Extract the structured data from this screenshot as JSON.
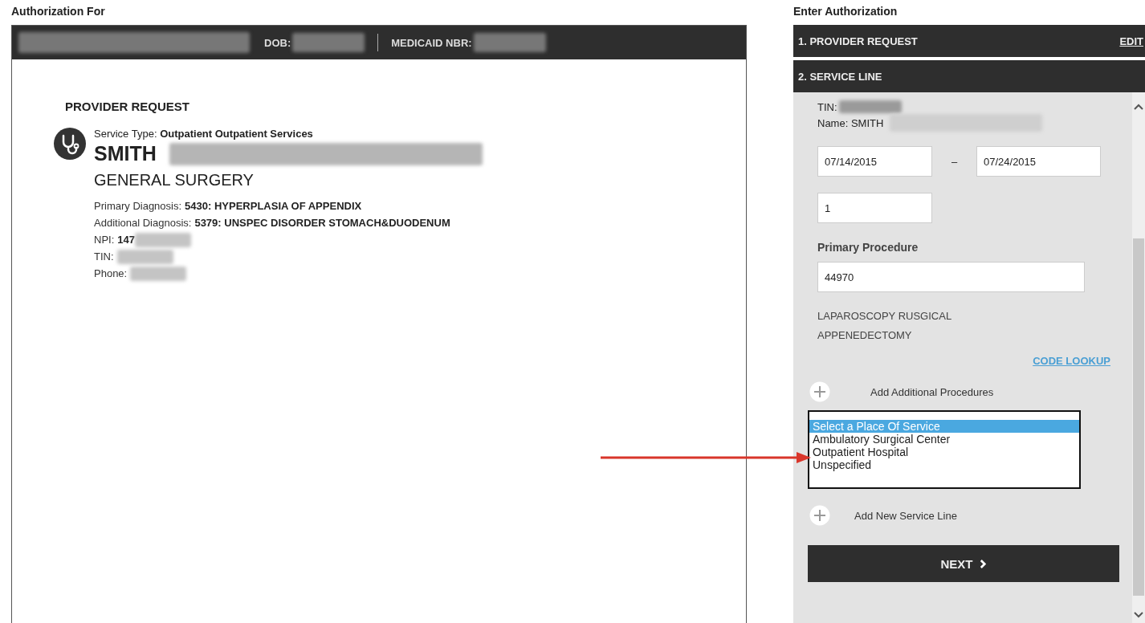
{
  "left": {
    "title": "Authorization For",
    "header": {
      "dob_label": "DOB:",
      "medicaid_label": "MEDICAID NBR:"
    },
    "section_title": "PROVIDER REQUEST",
    "service_type": "Service Type: **Outpatient Outpatient Services**",
    "provider_name": "SMITH",
    "specialty": "GENERAL SURGERY",
    "details": [
      {
        "label": "Primary Diagnosis:",
        "value": "5430: HYPERPLASIA OF APPENDIX",
        "redacted": false
      },
      {
        "label": "Additional Diagnosis:",
        "value": "5379: UNSPEC DISORDER STOMACH&DUODENUM",
        "redacted": false
      },
      {
        "label": "NPI:",
        "value": "147",
        "redacted": true
      },
      {
        "label": "TIN:",
        "redacted": true
      },
      {
        "label": "Phone:",
        "redacted": true
      }
    ]
  },
  "right": {
    "title": "Enter Authorization",
    "steps": [
      {
        "label": "1. PROVIDER REQUEST",
        "action": "EDIT"
      },
      {
        "label": "2. SERVICE LINE"
      }
    ],
    "tin_label": "TIN:",
    "name_label": "Name: SMITH",
    "start_date": "07/14/2015",
    "date_separator": "–",
    "end_date": "07/24/2015",
    "quantity": "1",
    "procedure_label": "Primary Procedure",
    "procedure_code": "44970",
    "procedure_description": "LAPAROSCOPY RUSGICAL APPENEDECTOMY",
    "code_lookup": "CODE LOOKUP",
    "add_procedures": "Add Additional Procedures",
    "place_of_service": [
      {
        "label": "Select a Place Of Service",
        "selected": true
      },
      {
        "label": "Ambulatory Surgical Center",
        "selected": false
      },
      {
        "label": "Outpatient Hospital",
        "selected": false
      },
      {
        "label": "Unspecified",
        "selected": false
      }
    ],
    "add_service_line": "Add New Service Line",
    "next": "NEXT"
  }
}
